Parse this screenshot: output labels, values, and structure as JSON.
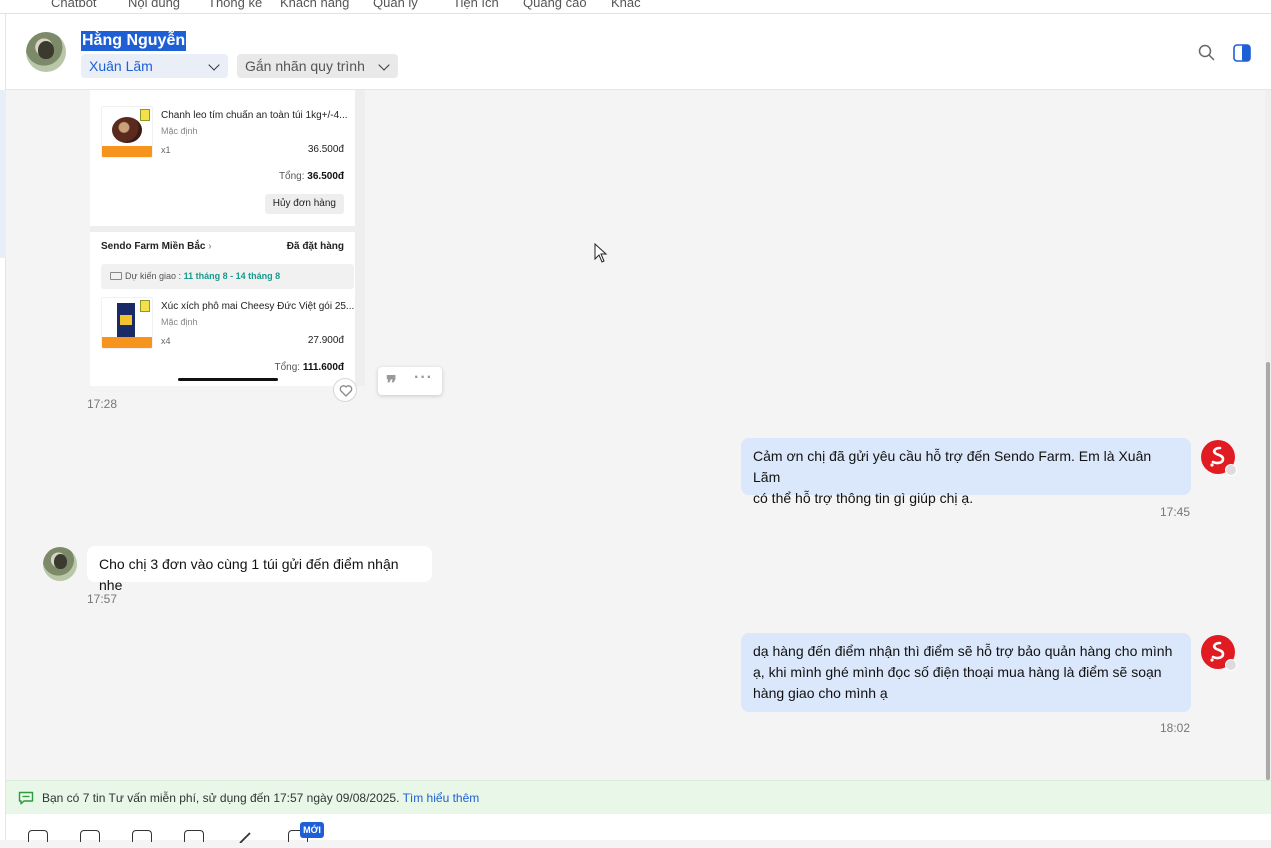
{
  "topnav": {
    "items": [
      "Chatbot",
      "Nội dung",
      "Thống kê",
      "Khách hàng",
      "Quản lý",
      "Tiện ích",
      "Quảng cáo",
      "Khác"
    ]
  },
  "header": {
    "customer_name": "Hằng Nguyễn",
    "assignee": "Xuân Lãm",
    "label_placeholder": "Gắn nhãn quy trình"
  },
  "shared_image": {
    "order1": {
      "product_name": "Chanh leo tím chuẩn an toàn túi 1kg+/-4...",
      "variant": "Mặc định",
      "qty": "x1",
      "price": "36.500đ",
      "total_label": "Tổng:",
      "total_value": "36.500đ",
      "cancel_button": "Hủy đơn hàng"
    },
    "order2": {
      "shop_name": "Sendo Farm Miền Bắc",
      "status": "Đã đặt hàng",
      "eta_label": "Dự kiến giao :",
      "eta_value": "11 tháng 8 - 14 tháng 8",
      "product_name": "Xúc xích phô mai Cheesy Đức Việt gói 25...",
      "variant": "Mặc định",
      "qty": "x4",
      "price": "27.900đ",
      "total_label": "Tổng:",
      "total_value": "111.600đ"
    },
    "time": "17:28"
  },
  "messages": [
    {
      "direction": "out",
      "text_line1": "Cảm ơn chị đã gửi yêu cầu hỗ trợ đến Sendo Farm. Em là Xuân Lãm",
      "text_line2": "có thể hỗ trợ thông tin gì giúp chị ạ.",
      "time": "17:45"
    },
    {
      "direction": "in",
      "text": "Cho chị 3 đơn vào cùng 1 túi gửi đến điểm nhận nhe",
      "time": "17:57"
    },
    {
      "direction": "out",
      "text_line1": "dạ hàng đến điểm nhận thì điểm sẽ hỗ trợ bảo quản hàng cho mình",
      "text_line2": "ạ, khi mình ghé mình đọc số điện thoại mua hàng là điểm sẽ soạn",
      "text_line3": "hàng giao cho mình ạ",
      "time": "18:02"
    }
  ],
  "notice": {
    "text": "Bạn có 7 tin Tư vấn miễn phí, sử dụng đến 17:57 ngày 09/08/2025.",
    "link": "Tìm hiểu thêm"
  },
  "toolbar": {
    "new_badge": "MỚI"
  },
  "colors": {
    "accent": "#1e5fd6",
    "outgoing_bubble": "#dbe7fb",
    "shop_avatar": "#e11b22",
    "notice_bg": "#e8f7e8"
  }
}
